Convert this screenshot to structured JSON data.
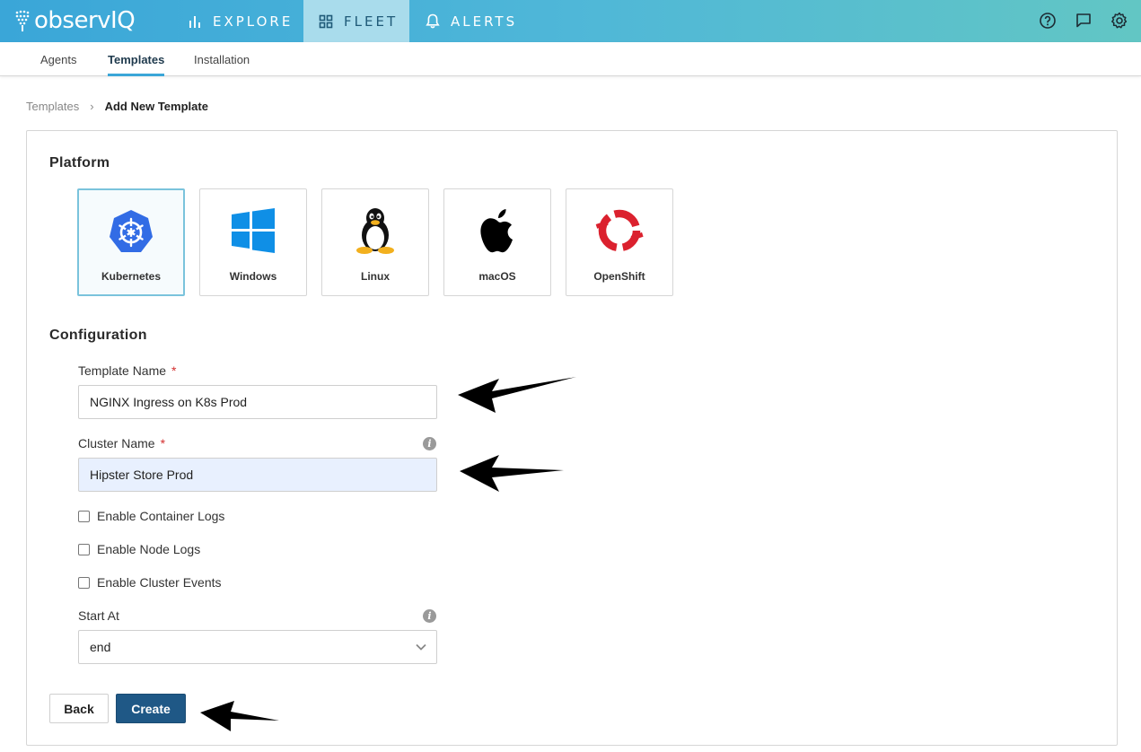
{
  "app": {
    "logo_text": "observIQ",
    "nav": [
      {
        "label": "EXPLORE",
        "icon": "bar-chart-icon"
      },
      {
        "label": "FLEET",
        "icon": "grid-icon"
      },
      {
        "label": "ALERTS",
        "icon": "bell-icon"
      }
    ],
    "active_nav": "FLEET",
    "top_icons": [
      "help-icon",
      "chat-icon",
      "gear-icon"
    ]
  },
  "subnav": {
    "tabs": [
      "Agents",
      "Templates",
      "Installation"
    ],
    "active": "Templates"
  },
  "breadcrumb": {
    "parent": "Templates",
    "separator": "›",
    "current": "Add New Template"
  },
  "platform": {
    "title": "Platform",
    "options": [
      "Kubernetes",
      "Windows",
      "Linux",
      "macOS",
      "OpenShift"
    ],
    "selected": "Kubernetes"
  },
  "configuration": {
    "title": "Configuration",
    "template_name": {
      "label": "Template Name",
      "required_mark": "*",
      "value": "NGINX Ingress on K8s Prod"
    },
    "cluster_name": {
      "label": "Cluster Name",
      "required_mark": "*",
      "value": "Hipster Store Prod",
      "info": "i"
    },
    "checkboxes": [
      {
        "label": "Enable Container Logs",
        "checked": false
      },
      {
        "label": "Enable Node Logs",
        "checked": false
      },
      {
        "label": "Enable Cluster Events",
        "checked": false
      }
    ],
    "start_at": {
      "label": "Start At",
      "value": "end",
      "info": "i"
    }
  },
  "actions": {
    "back_label": "Back",
    "create_label": "Create"
  },
  "colors": {
    "accent": "#3aa6d8",
    "primary_button": "#1f5886",
    "required": "#d32f2f",
    "autofill_bg": "#e8f0fe"
  }
}
